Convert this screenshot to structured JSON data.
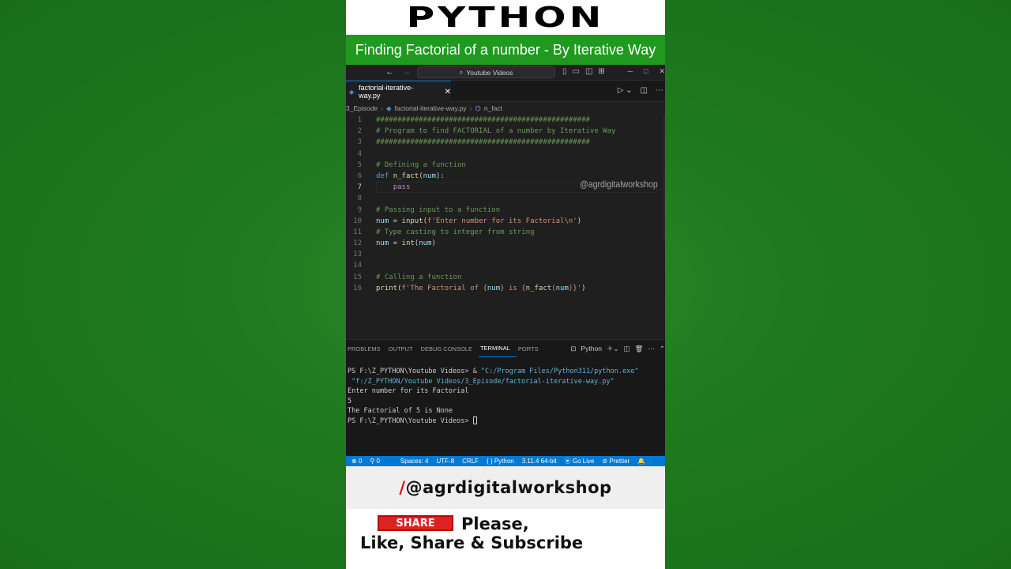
{
  "banner": {
    "title": "PYTHON",
    "subtitle": "Finding Factorial of a number - By Iterative Way"
  },
  "titlebar": {
    "back": "←",
    "forward": "→",
    "search_label": "Youtube Videos"
  },
  "editor_tab": {
    "filename": "factorial-iterative-way.py",
    "close": "✕"
  },
  "breadcrumb": {
    "folder": "3_Episode",
    "file": "factorial-iterative-way.py",
    "symbol": "n_fact"
  },
  "code_lines": [
    {
      "n": "1",
      "text": "##################################################"
    },
    {
      "n": "2",
      "text": "# Program to find FACTORIAL of a number by Iterative Way"
    },
    {
      "n": "3",
      "text": "##################################################"
    },
    {
      "n": "4",
      "text": ""
    },
    {
      "n": "5",
      "text": "# Defining a function"
    },
    {
      "n": "6",
      "text": "def n_fact(num):"
    },
    {
      "n": "7",
      "text": "    pass"
    },
    {
      "n": "8",
      "text": ""
    },
    {
      "n": "9",
      "text": "# Passing input to a function"
    },
    {
      "n": "10",
      "text": "num = input(f'Enter number for its Factorial\\n')"
    },
    {
      "n": "11",
      "text": "# Type casting to integer from string"
    },
    {
      "n": "12",
      "text": "num = int(num)"
    },
    {
      "n": "13",
      "text": ""
    },
    {
      "n": "14",
      "text": ""
    },
    {
      "n": "15",
      "text": "# Calling a function"
    },
    {
      "n": "16",
      "text": "print(f'The Factorial of {num} is {n_fact(num)}')"
    }
  ],
  "watermark": "@agrdigitalworkshop",
  "panel": {
    "tabs": [
      "PROBLEMS",
      "OUTPUT",
      "DEBUG CONSOLE",
      "TERMINAL",
      "PORTS"
    ],
    "active_tab": "TERMINAL",
    "shell_label": "Python"
  },
  "terminal": {
    "prompt1": "PS F:\\Z_PYTHON\\Youtube Videos> & ",
    "exe_path": "\"C:/Program Files/Python311/python.exe\"",
    "script_path": " \"f:/Z_PYTHON/Youtube Videos/3_Episode/factorial-iterative-way.py\"",
    "out1": "Enter number for its Factorial",
    "out2": "5",
    "out3": "The Factorial of 5 is None",
    "prompt2": "PS F:\\Z_PYTHON\\Youtube Videos> "
  },
  "statusbar": {
    "errors": "⊗ 0",
    "ports": "⚲ 0",
    "spaces": "Spaces: 4",
    "encoding": "UTF-8",
    "eol": "CRLF",
    "language": "{ } Python",
    "interpreter": "3.11.4 64-bit",
    "golive": "Go Live",
    "prettier": "Prettier"
  },
  "footer": {
    "handle_slash": "/",
    "handle": "@agrdigitalworkshop",
    "share": "SHARE",
    "cta1": "Please,",
    "cta2": "Like, Share & Subscribe"
  },
  "colors": {
    "background_green": "#1f7a1f",
    "subtitle_green": "#1f9a1f",
    "statusbar_blue": "#0078d4",
    "share_red": "#dd2222"
  }
}
